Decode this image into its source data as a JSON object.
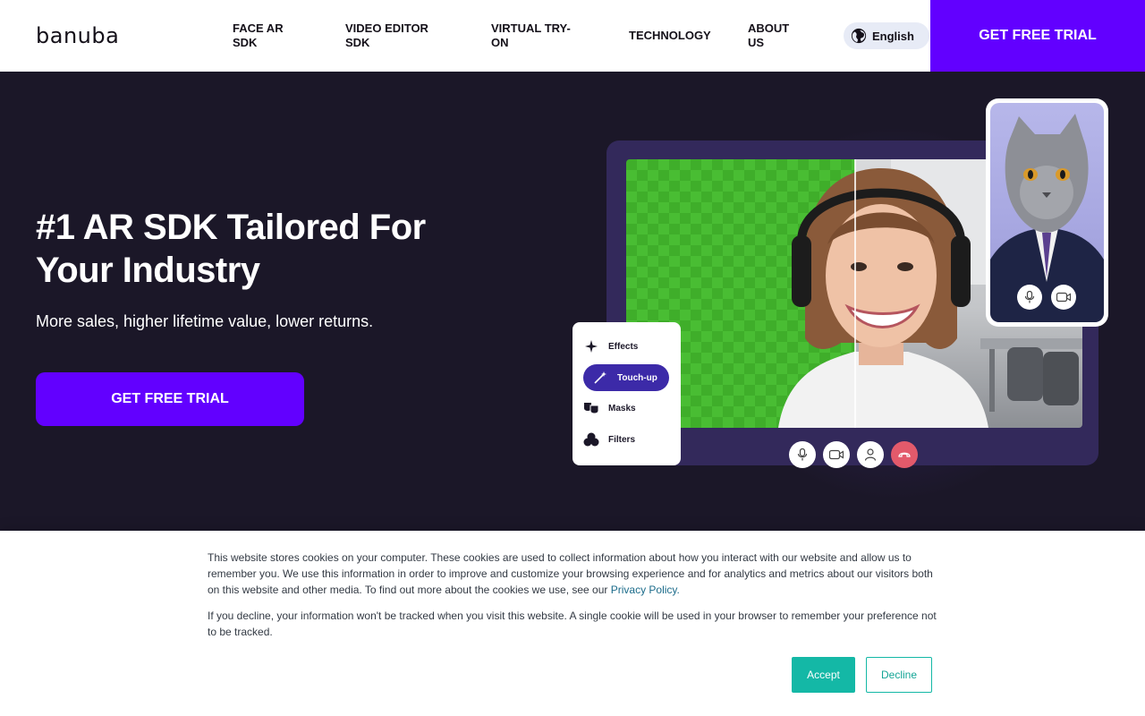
{
  "header": {
    "logo_text": "banuba",
    "nav": [
      {
        "label": "FACE AR SDK"
      },
      {
        "label": "VIDEO EDITOR SDK"
      },
      {
        "label": "VIRTUAL TRY-ON"
      },
      {
        "label": "TECHNOLOGY"
      },
      {
        "label": "ABOUT US"
      }
    ],
    "language": {
      "label": "English",
      "icon": "globe-icon"
    },
    "cta_label": "GET FREE TRIAL"
  },
  "hero": {
    "title": "#1 AR SDK Tailored For Your Industry",
    "subtitle": "More sales, higher lifetime value, lower returns.",
    "cta_label": "GET FREE TRIAL",
    "effects_panel": [
      {
        "label": "Effects",
        "icon": "sparkle-icon",
        "active": false
      },
      {
        "label": "Touch-up",
        "icon": "magic-wand-icon",
        "active": true
      },
      {
        "label": "Masks",
        "icon": "theater-masks-icon",
        "active": false
      },
      {
        "label": "Filters",
        "icon": "filters-icon",
        "active": false
      }
    ],
    "call_controls": [
      "microphone-icon",
      "camera-icon",
      "person-icon",
      "hang-up-icon"
    ],
    "phone_controls": [
      "microphone-icon",
      "camera-icon"
    ]
  },
  "cookie_banner": {
    "text_1": "This website stores cookies on your computer. These cookies are used to collect information about how you interact with our website and allow us to remember you. We use this information in order to improve and customize your browsing experience and for analytics and metrics about our visitors both on this website and other media. To find out more about the cookies we use, see our",
    "privacy_link": "Privacy Policy.",
    "text_2": "If you decline, your information won't be tracked when you visit this website. A single cookie will be used in your browser to remember your preference not to be tracked.",
    "accept_label": "Accept",
    "decline_label": "Decline"
  },
  "colors": {
    "brand_purple": "#6200ff",
    "hero_background": "#1b1728",
    "accept_teal": "#14b8a6"
  }
}
